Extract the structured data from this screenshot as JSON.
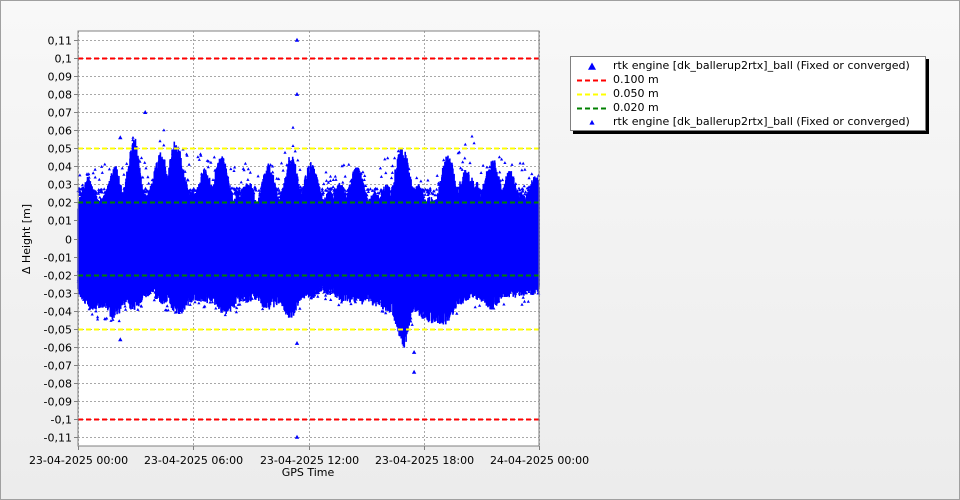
{
  "chart_data": {
    "type": "scatter",
    "xlabel": "GPS Time",
    "ylabel": "Δ Height [m]",
    "xlim": [
      "2025-04-23 00:00",
      "2025-04-24 00:00"
    ],
    "ylim": [
      -0.115,
      0.115
    ],
    "grid": true,
    "legend_position": "right",
    "y_ticks": [
      0.11,
      0.1,
      0.09,
      0.08,
      0.07,
      0.06,
      0.05,
      0.04,
      0.03,
      0.02,
      0.01,
      0,
      -0.01,
      -0.02,
      -0.03,
      -0.04,
      -0.05,
      -0.06,
      -0.07,
      -0.08,
      -0.09,
      -0.1,
      -0.11
    ],
    "y_tick_labels": [
      "0,11",
      "0,1",
      "0,09",
      "0,08",
      "0,07",
      "0,06",
      "0,05",
      "0,04",
      "0,03",
      "0,02",
      "0,01",
      "0",
      "-0,01",
      "-0,02",
      "-0,03",
      "-0,04",
      "-0,05",
      "-0,06",
      "-0,07",
      "-0,08",
      "-0,09",
      "-0,1",
      "-0,11"
    ],
    "x_ticks": [
      "2025-04-23 00:00",
      "2025-04-23 06:00",
      "2025-04-23 12:00",
      "2025-04-23 18:00",
      "2025-04-24 00:00"
    ],
    "x_tick_labels": [
      "23-04-2025 00:00",
      "23-04-2025 06:00",
      "23-04-2025 12:00",
      "23-04-2025 18:00",
      "24-04-2025 00:00"
    ],
    "thresholds": [
      {
        "name": "0.100 m",
        "values": [
          0.1,
          -0.1
        ],
        "color": "#ff0000"
      },
      {
        "name": "0.050 m",
        "values": [
          0.05,
          -0.05
        ],
        "color": "#ffff00"
      },
      {
        "name": "0.020 m",
        "values": [
          0.02,
          -0.02
        ],
        "color": "#008000"
      }
    ],
    "series": [
      {
        "name": "rtk engine [dk_ballerup2rtx]_ball (Fixed or converged)",
        "color": "#0000ff",
        "marker": "triangle",
        "envelope": {
          "hours": [
            0,
            0.5,
            1,
            1.5,
            2,
            2.5,
            3,
            3.5,
            4,
            4.5,
            5,
            5.5,
            6,
            6.5,
            7,
            7.5,
            8,
            8.5,
            9,
            9.5,
            10,
            10.5,
            11,
            11.5,
            12,
            12.5,
            13,
            13.5,
            14,
            14.5,
            15,
            15.5,
            16,
            16.5,
            17,
            17.5,
            18,
            18.5,
            19,
            19.5,
            20,
            20.5,
            21,
            21.5,
            22,
            22.5,
            23,
            23.5,
            24
          ],
          "upper": [
            0.035,
            0.038,
            0.04,
            0.042,
            0.048,
            0.045,
            0.065,
            0.045,
            0.052,
            0.063,
            0.06,
            0.05,
            0.045,
            0.048,
            0.05,
            0.048,
            0.04,
            0.045,
            0.04,
            0.035,
            0.045,
            0.04,
            0.075,
            0.045,
            0.045,
            0.038,
            0.04,
            0.045,
            0.042,
            0.04,
            0.038,
            0.04,
            0.045,
            0.05,
            0.052,
            0.048,
            0.04,
            0.035,
            0.045,
            0.048,
            0.05,
            0.06,
            0.045,
            0.045,
            0.048,
            0.05,
            0.045,
            0.04,
            0.035
          ],
          "lower": [
            -0.035,
            -0.04,
            -0.045,
            -0.045,
            -0.048,
            -0.04,
            -0.042,
            -0.038,
            -0.035,
            -0.04,
            -0.042,
            -0.045,
            -0.04,
            -0.038,
            -0.04,
            -0.042,
            -0.045,
            -0.04,
            -0.038,
            -0.04,
            -0.04,
            -0.042,
            -0.052,
            -0.04,
            -0.035,
            -0.032,
            -0.035,
            -0.038,
            -0.04,
            -0.035,
            -0.04,
            -0.042,
            -0.045,
            -0.05,
            -0.062,
            -0.045,
            -0.05,
            -0.055,
            -0.05,
            -0.045,
            -0.04,
            -0.038,
            -0.04,
            -0.04,
            -0.038,
            -0.035,
            -0.038,
            -0.035,
            -0.03
          ],
          "upper_band": 0.026,
          "lower_band": -0.028
        },
        "outliers": [
          {
            "hour": 2.2,
            "value": 0.056
          },
          {
            "hour": 2.2,
            "value": -0.056
          },
          {
            "hour": 3.5,
            "value": 0.07
          },
          {
            "hour": 11.4,
            "value": 0.11
          },
          {
            "hour": 11.4,
            "value": 0.08
          },
          {
            "hour": 11.4,
            "value": -0.11
          },
          {
            "hour": 11.4,
            "value": -0.058
          },
          {
            "hour": 17.5,
            "value": -0.074
          },
          {
            "hour": 17.5,
            "value": -0.063
          }
        ]
      }
    ]
  },
  "legend": {
    "items": [
      {
        "label": "rtk engine [dk_ballerup2rtx]_ball (Fixed or converged)",
        "symbol": "triangle-large",
        "color": "#0000ff"
      },
      {
        "label": "0.100 m",
        "symbol": "dashed-line",
        "color": "#ff0000"
      },
      {
        "label": "0.050 m",
        "symbol": "dashed-line",
        "color": "#ffff00"
      },
      {
        "label": "0.020 m",
        "symbol": "dashed-line",
        "color": "#008000"
      },
      {
        "label": "rtk engine [dk_ballerup2rtx]_ball (Fixed or converged)",
        "symbol": "triangle-small",
        "color": "#0000ff"
      }
    ]
  }
}
